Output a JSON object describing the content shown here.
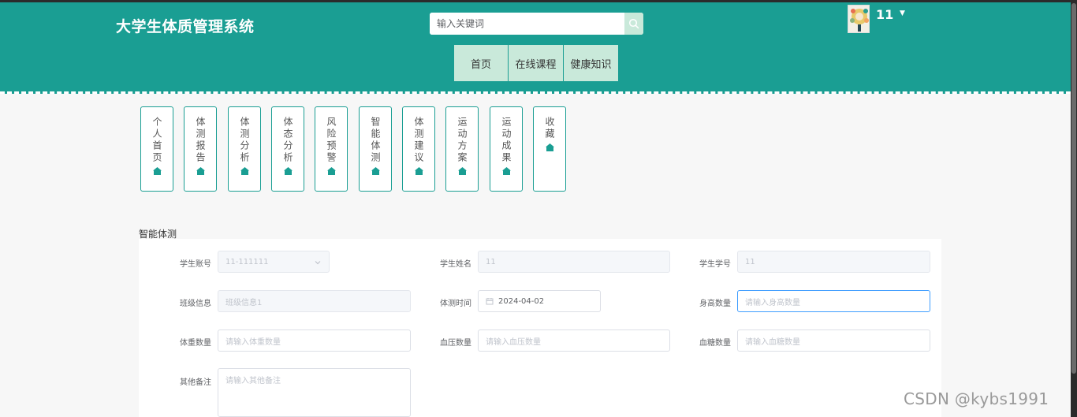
{
  "header": {
    "title": "大学生体质管理系统",
    "search_placeholder": "输入关键词",
    "username": "11"
  },
  "nav": [
    "首页",
    "在线课程",
    "健康知识"
  ],
  "side_menu": [
    "个人首页",
    "体测报告",
    "体测分析",
    "体态分析",
    "风险预警",
    "智能体测",
    "体测建议",
    "运动方案",
    "运动成果",
    "收藏"
  ],
  "form": {
    "title": "智能体测",
    "fields": {
      "account": {
        "label": "学生账号",
        "value": "11-111111"
      },
      "name": {
        "label": "学生姓名",
        "value": "11"
      },
      "student_no": {
        "label": "学生学号",
        "value": "11"
      },
      "class_info": {
        "label": "班级信息",
        "placeholder": "班级信息1"
      },
      "test_time": {
        "label": "体测时间",
        "value": "2024-04-02"
      },
      "height": {
        "label": "身高数量",
        "placeholder": "请输入身高数量"
      },
      "weight": {
        "label": "体重数量",
        "placeholder": "请输入体重数量"
      },
      "blood_pressure": {
        "label": "血压数量",
        "placeholder": "请输入血压数量"
      },
      "blood_sugar": {
        "label": "血糖数量",
        "placeholder": "请输入血糖数量"
      },
      "remarks": {
        "label": "其他备注",
        "placeholder": "请输入其他备注"
      }
    }
  },
  "watermark": "CSDN @kybs1991",
  "colors": {
    "accent": "#1a9e93",
    "nav_bg": "#c9e9da",
    "focus": "#409eff"
  },
  "icons": [
    "search-icon",
    "chevron-down-icon",
    "calendar-icon",
    "home-icon",
    "caret-down-icon"
  ]
}
